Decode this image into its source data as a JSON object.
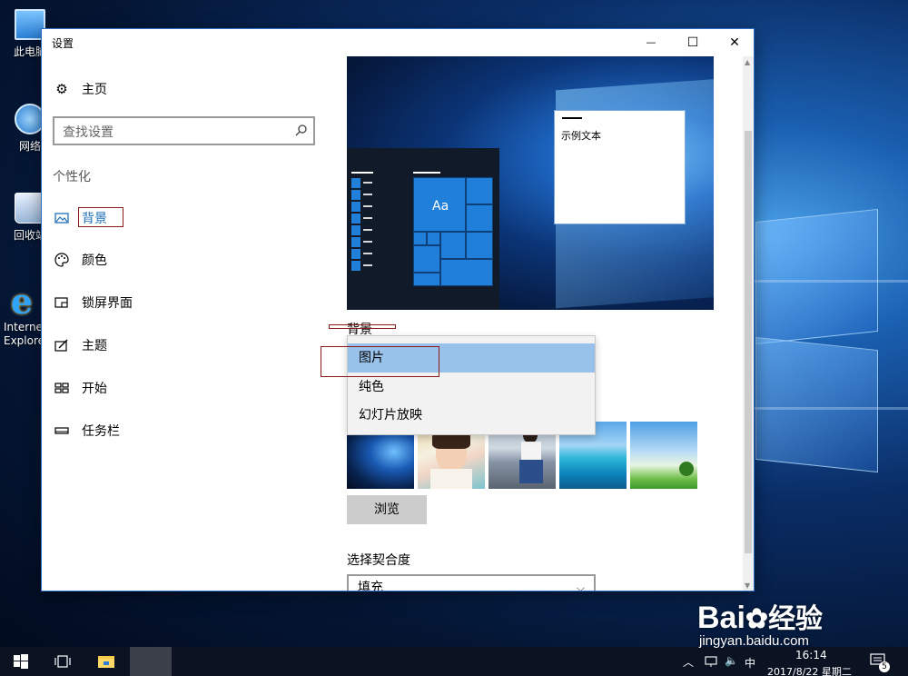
{
  "desktop": {
    "icons": [
      {
        "label": "此电脑"
      },
      {
        "label": "网络"
      },
      {
        "label": "回收站"
      },
      {
        "label": "Internet Explorer"
      }
    ]
  },
  "window": {
    "title": "设置",
    "controls": {
      "minimize": "—",
      "maximize": "☐",
      "close": "✕"
    }
  },
  "sidebar": {
    "home_label": "主页",
    "search_placeholder": "查找设置",
    "section_heading": "个性化",
    "items": [
      {
        "label": "背景",
        "icon": "image-icon",
        "selected": true
      },
      {
        "label": "颜色",
        "icon": "palette-icon"
      },
      {
        "label": "锁屏界面",
        "icon": "lock-screen-icon"
      },
      {
        "label": "主题",
        "icon": "theme-icon"
      },
      {
        "label": "开始",
        "icon": "start-icon"
      },
      {
        "label": "任务栏",
        "icon": "taskbar-icon"
      }
    ]
  },
  "preview": {
    "tile_text": "Aa",
    "sample_text": "示例文本"
  },
  "background": {
    "label": "背景",
    "options": [
      "图片",
      "纯色",
      "幻灯片放映"
    ],
    "selected_option": "图片",
    "browse_label": "浏览",
    "fit_label": "选择契合度",
    "fit_value": "填充"
  },
  "taskbar": {
    "time": "16:14",
    "date": "2017/8/22 星期二",
    "ime": "中",
    "notification_count": "5"
  },
  "watermark": {
    "brand": "Bai",
    "brand_cn": "经验",
    "url": "jingyan.baidu.com"
  },
  "colors": {
    "accent": "#1f7fd9",
    "selection": "#99c2eb",
    "annotation_box": "#8b1a1a"
  }
}
